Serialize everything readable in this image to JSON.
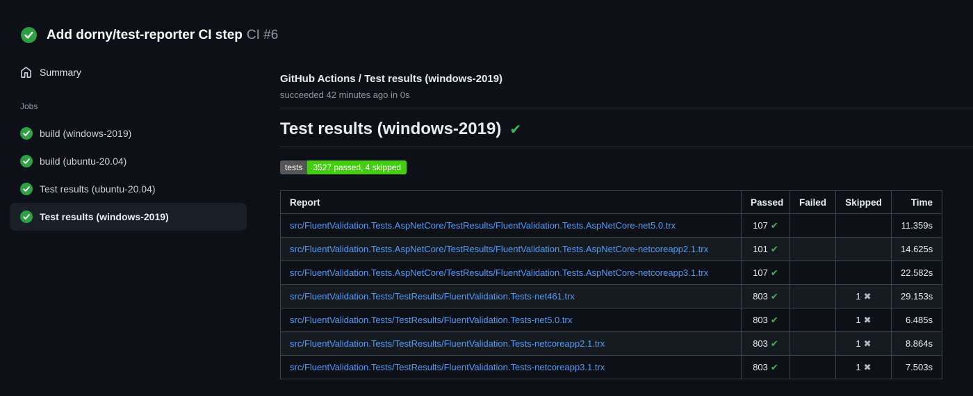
{
  "header": {
    "title": "Add dorny/test-reporter CI step",
    "run_number": "CI #6"
  },
  "sidebar": {
    "summary_label": "Summary",
    "jobs_label": "Jobs",
    "jobs": [
      {
        "label": "build (windows-2019)",
        "selected": false
      },
      {
        "label": "build (ubuntu-20.04)",
        "selected": false
      },
      {
        "label": "Test results (ubuntu-20.04)",
        "selected": false
      },
      {
        "label": "Test results (windows-2019)",
        "selected": true
      }
    ]
  },
  "main": {
    "job_title": "GitHub Actions / Test results (windows-2019)",
    "job_status": "succeeded 42 minutes ago in 0s",
    "section_heading": "Test results (windows-2019)",
    "badge": {
      "label": "tests",
      "value": "3527 passed, 4 skipped",
      "label_bg": "#555555",
      "value_bg": "#44cc11"
    },
    "table": {
      "columns": [
        "Report",
        "Passed",
        "Failed",
        "Skipped",
        "Time"
      ],
      "rows": [
        {
          "report": "src/FluentValidation.Tests.AspNetCore/TestResults/FluentValidation.Tests.AspNetCore-net5.0.trx",
          "passed": "107",
          "passed_mark": "✔",
          "failed": "",
          "skipped": "",
          "skipped_mark": "",
          "time": "11.359s"
        },
        {
          "report": "src/FluentValidation.Tests.AspNetCore/TestResults/FluentValidation.Tests.AspNetCore-netcoreapp2.1.trx",
          "passed": "101",
          "passed_mark": "✔",
          "failed": "",
          "skipped": "",
          "skipped_mark": "",
          "time": "14.625s"
        },
        {
          "report": "src/FluentValidation.Tests.AspNetCore/TestResults/FluentValidation.Tests.AspNetCore-netcoreapp3.1.trx",
          "passed": "107",
          "passed_mark": "✔",
          "failed": "",
          "skipped": "",
          "skipped_mark": "",
          "time": "22.582s"
        },
        {
          "report": "src/FluentValidation.Tests/TestResults/FluentValidation.Tests-net461.trx",
          "passed": "803",
          "passed_mark": "✔",
          "failed": "",
          "skipped": "1",
          "skipped_mark": "✖",
          "time": "29.153s"
        },
        {
          "report": "src/FluentValidation.Tests/TestResults/FluentValidation.Tests-net5.0.trx",
          "passed": "803",
          "passed_mark": "✔",
          "failed": "",
          "skipped": "1",
          "skipped_mark": "✖",
          "time": "6.485s"
        },
        {
          "report": "src/FluentValidation.Tests/TestResults/FluentValidation.Tests-netcoreapp2.1.trx",
          "passed": "803",
          "passed_mark": "✔",
          "failed": "",
          "skipped": "1",
          "skipped_mark": "✖",
          "time": "8.864s"
        },
        {
          "report": "src/FluentValidation.Tests/TestResults/FluentValidation.Tests-netcoreapp3.1.trx",
          "passed": "803",
          "passed_mark": "✔",
          "failed": "",
          "skipped": "1",
          "skipped_mark": "✖",
          "time": "7.503s"
        }
      ]
    }
  },
  "icons": {
    "heading_check": "✔",
    "status": "check-circle"
  },
  "colors": {
    "success_green": "#3fb950",
    "status_circle_green": "#2ea043",
    "link_blue": "#539bf5",
    "badge_label_bg": "#555555",
    "badge_value_bg": "#44cc11"
  }
}
